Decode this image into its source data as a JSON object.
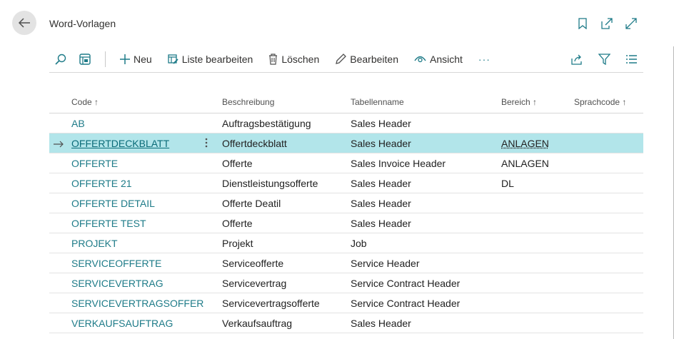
{
  "header": {
    "title": "Word-Vorlagen"
  },
  "actions": {
    "neu": "Neu",
    "liste_bearbeiten": "Liste bearbeiten",
    "loeschen": "Löschen",
    "bearbeiten": "Bearbeiten",
    "ansicht": "Ansicht",
    "more": "···"
  },
  "columns": {
    "code": "Code ↑",
    "beschreibung": "Beschreibung",
    "tabellenname": "Tabellenname",
    "bereich": "Bereich ↑",
    "sprachcode": "Sprachcode ↑"
  },
  "rows": [
    {
      "code": "AB",
      "beschreibung": "Auftragsbestätigung",
      "tabellenname": "Sales Header",
      "bereich": ""
    },
    {
      "code": "OFFERTDECKBLATT",
      "beschreibung": "Offertdeckblatt",
      "tabellenname": "Sales Header",
      "bereich": "ANLAGEN"
    },
    {
      "code": "OFFERTE",
      "beschreibung": "Offerte",
      "tabellenname": "Sales Invoice Header",
      "bereich": "ANLAGEN"
    },
    {
      "code": "OFFERTE 21",
      "beschreibung": "Dienstleistungsofferte",
      "tabellenname": "Sales Header",
      "bereich": "DL"
    },
    {
      "code": "OFFERTE DETAIL",
      "beschreibung": "Offerte Deatil",
      "tabellenname": "Sales Header",
      "bereich": ""
    },
    {
      "code": "OFFERTE TEST",
      "beschreibung": "Offerte",
      "tabellenname": "Sales Header",
      "bereich": ""
    },
    {
      "code": "PROJEKT",
      "beschreibung": "Projekt",
      "tabellenname": "Job",
      "bereich": ""
    },
    {
      "code": "SERVICEOFFERTE",
      "beschreibung": "Serviceofferte",
      "tabellenname": "Service Header",
      "bereich": ""
    },
    {
      "code": "SERVICEVERTRAG",
      "beschreibung": "Servicevertrag",
      "tabellenname": "Service Contract Header",
      "bereich": ""
    },
    {
      "code": "SERVICEVERTRAGSOFFER",
      "beschreibung": "Servicevertragsofferte",
      "tabellenname": "Service Contract Header",
      "bereich": ""
    },
    {
      "code": "VERKAUFSAUFTRAG",
      "beschreibung": "Verkaufsauftrag",
      "tabellenname": "Sales Header",
      "bereich": ""
    }
  ],
  "selected_row": 1,
  "colors": {
    "accent": "#1e7b88",
    "selected_row": "#b2e5ea"
  }
}
